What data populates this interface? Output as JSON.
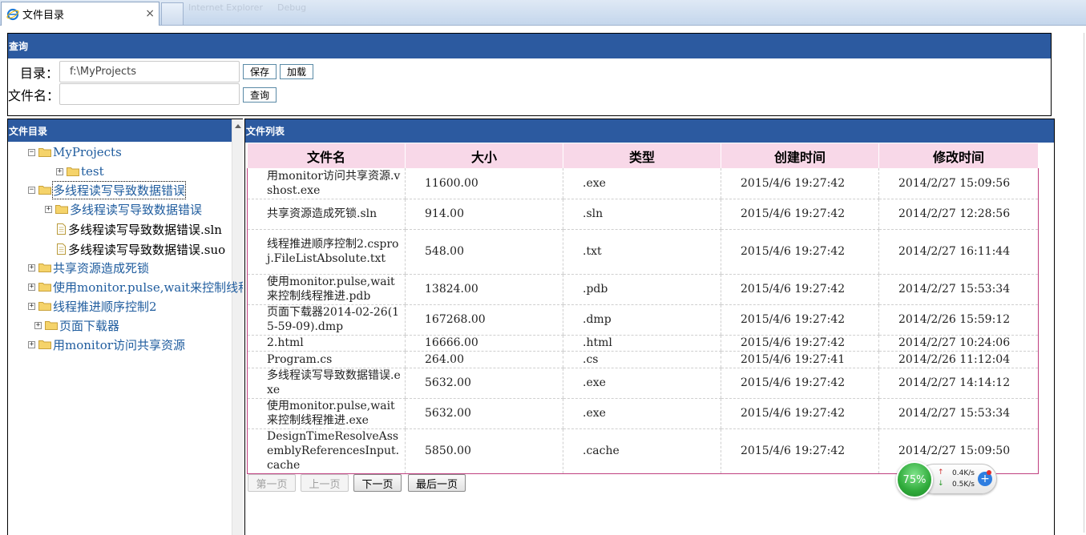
{
  "browser": {
    "tab_title": "文件目录",
    "close_glyph": "×",
    "ghost_toolbar": [
      "Internet Explorer",
      "Debug"
    ]
  },
  "query": {
    "header": "查询",
    "dir_label": "目录：",
    "dir_value": "f:\\MyProjects",
    "save_label": "保存",
    "load_label": "加载",
    "filename_label": "文件名：",
    "filename_value": "",
    "search_label": "查询"
  },
  "tree": {
    "header": "文件目录",
    "nodes": [
      {
        "label": "MyProjects",
        "kind": "folder",
        "expander": "−"
      },
      {
        "label": "test",
        "kind": "folder",
        "expander": "+"
      },
      {
        "label": "多线程读写导致数据错误",
        "kind": "folder",
        "expander": "−"
      },
      {
        "label": "多线程读写导致数据错误",
        "kind": "folder",
        "expander": "+"
      },
      {
        "label": "多线程读写导致数据错误.sln",
        "kind": "file"
      },
      {
        "label": "多线程读写导致数据错误.suo",
        "kind": "file"
      },
      {
        "label": "共享资源造成死锁",
        "kind": "folder",
        "expander": "+"
      },
      {
        "label": "使用monitor.pulse,wait来控制线程",
        "kind": "folder",
        "expander": "+"
      },
      {
        "label": "线程推进顺序控制2",
        "kind": "folder",
        "expander": "+"
      },
      {
        "label": "页面下载器",
        "kind": "folder",
        "expander": "+"
      },
      {
        "label": "用monitor访问共享资源",
        "kind": "folder",
        "expander": "+"
      }
    ]
  },
  "files": {
    "header": "文件列表",
    "columns": [
      "文件名",
      "大小",
      "类型",
      "创建时间",
      "修改时间"
    ],
    "rows": [
      {
        "name": "用monitor访问共享资源.vshost.exe",
        "size": "11600.00",
        "type": ".exe",
        "created": "2015/4/6 19:27:42",
        "modified": "2014/2/27 15:09:56"
      },
      {
        "name": "共享资源造成死锁.sln",
        "size": "914.00",
        "type": ".sln",
        "created": "2015/4/6 19:27:42",
        "modified": "2014/2/27 12:28:56"
      },
      {
        "name": "线程推进顺序控制2.csproj.FileListAbsolute.txt",
        "size": "548.00",
        "type": ".txt",
        "created": "2015/4/6 19:27:42",
        "modified": "2014/2/27 16:11:44"
      },
      {
        "name": "使用monitor.pulse,wait来控制线程推进.pdb",
        "size": "13824.00",
        "type": ".pdb",
        "created": "2015/4/6 19:27:42",
        "modified": "2014/2/27 15:53:34"
      },
      {
        "name": "页面下载器2014-02-26(15-59-09).dmp",
        "size": "167268.00",
        "type": ".dmp",
        "created": "2015/4/6 19:27:42",
        "modified": "2014/2/26 15:59:12"
      },
      {
        "name": "2.html",
        "size": "16666.00",
        "type": ".html",
        "created": "2015/4/6 19:27:42",
        "modified": "2014/2/27 10:24:06"
      },
      {
        "name": "Program.cs",
        "size": "264.00",
        "type": ".cs",
        "created": "2015/4/6 19:27:41",
        "modified": "2014/2/26 11:12:04"
      },
      {
        "name": "多线程读写导致数据错误.exe",
        "size": "5632.00",
        "type": ".exe",
        "created": "2015/4/6 19:27:42",
        "modified": "2014/2/27 14:14:12"
      },
      {
        "name": "使用monitor.pulse,wait来控制线程推进.exe",
        "size": "5632.00",
        "type": ".exe",
        "created": "2015/4/6 19:27:42",
        "modified": "2014/2/27 15:53:34"
      },
      {
        "name": "DesignTimeResolveAssemblyReferencesInput.cache",
        "size": "5850.00",
        "type": ".cache",
        "created": "2015/4/6 19:27:42",
        "modified": "2014/2/27 15:09:50"
      }
    ]
  },
  "pager": {
    "first": "第一页",
    "prev": "上一页",
    "next": "下一页",
    "last": "最后一页"
  },
  "network_widget": {
    "percent": "75%",
    "up_rate": "0.4K/s",
    "down_rate": "0.5K/s",
    "plus": "+"
  },
  "colors": {
    "panel_header": "#2c5aa0",
    "table_header": "#f8d8e8",
    "tree_link": "#1f5c9e"
  }
}
